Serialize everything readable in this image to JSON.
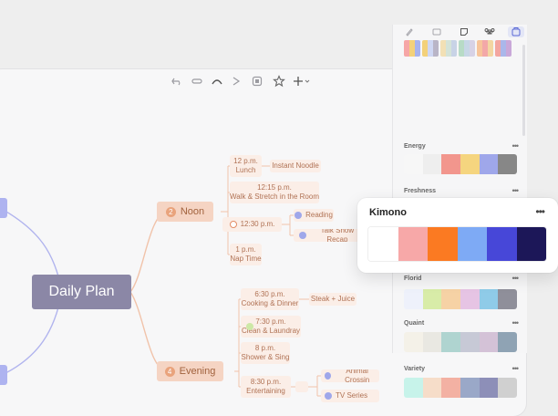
{
  "toolbar": {
    "icons": [
      "undo-icon",
      "redo-icon",
      "curve-icon",
      "forward-icon",
      "box-icon",
      "star-icon",
      "add-icon",
      "fullscreen-icon",
      "play-icon",
      "panel-toggle-icon"
    ]
  },
  "mindmap": {
    "root": "Daily Plan",
    "branches": [
      {
        "num": "2",
        "label": "Noon"
      },
      {
        "num": "4",
        "label": "Evening"
      }
    ],
    "noon_items": [
      {
        "time": "12 p.m.",
        "task": "Lunch",
        "sub": "Instant Noodle"
      },
      {
        "time": "12:15 p.m.",
        "task": "Walk & Stretch in the Room"
      },
      {
        "time": "12:30 p.m.",
        "subs": [
          "Reading",
          "Talk Show Recap"
        ]
      },
      {
        "time": "1 p.m.",
        "task": "Nap Time"
      }
    ],
    "evening_items": [
      {
        "time": "6:30 p.m.",
        "task": "Cooking & Dinner",
        "sub": "Steak + Juice"
      },
      {
        "time": "7:30 p.m.",
        "task": "Clean & Laundray"
      },
      {
        "time": "8 p.m.",
        "task": "Shower & Sing"
      },
      {
        "time": "8:30 p.m.",
        "task": "Entertaining",
        "subs": [
          "Animal Crossin",
          "TV Series"
        ]
      }
    ]
  },
  "panel": {
    "sections": [
      {
        "label": "Energy",
        "colors": [
          "#f7f7f7",
          "#eeeeee",
          "#f2968d",
          "#f5d57f",
          "#9fa7ea",
          "#878787"
        ]
      },
      {
        "label": "Freshness",
        "colors": []
      },
      {
        "label": "Florid",
        "colors": [
          "#eef1fb",
          "#d8eca8",
          "#f6d2a5",
          "#e6c4e4",
          "#8fcbe8",
          "#8f8f9a"
        ]
      },
      {
        "label": "Quaint",
        "colors": [
          "#f4f1e8",
          "#e9e8e2",
          "#afd4d0",
          "#c7c9d6",
          "#d4c2d7",
          "#8fa3b4"
        ]
      },
      {
        "label": "Variety",
        "colors": [
          "#c7f3ea",
          "#f6ddc9",
          "#f3b1a3",
          "#9aa8c8",
          "#8d8fb8",
          "#d0d0d0"
        ]
      }
    ],
    "more_label": "•••"
  },
  "popup": {
    "title": "Kimono",
    "more_label": "•••",
    "colors": [
      "#ffffff",
      "#f7a8a8",
      "#fb7a22",
      "#7eaaf5",
      "#4747d8",
      "#1c1758"
    ]
  }
}
